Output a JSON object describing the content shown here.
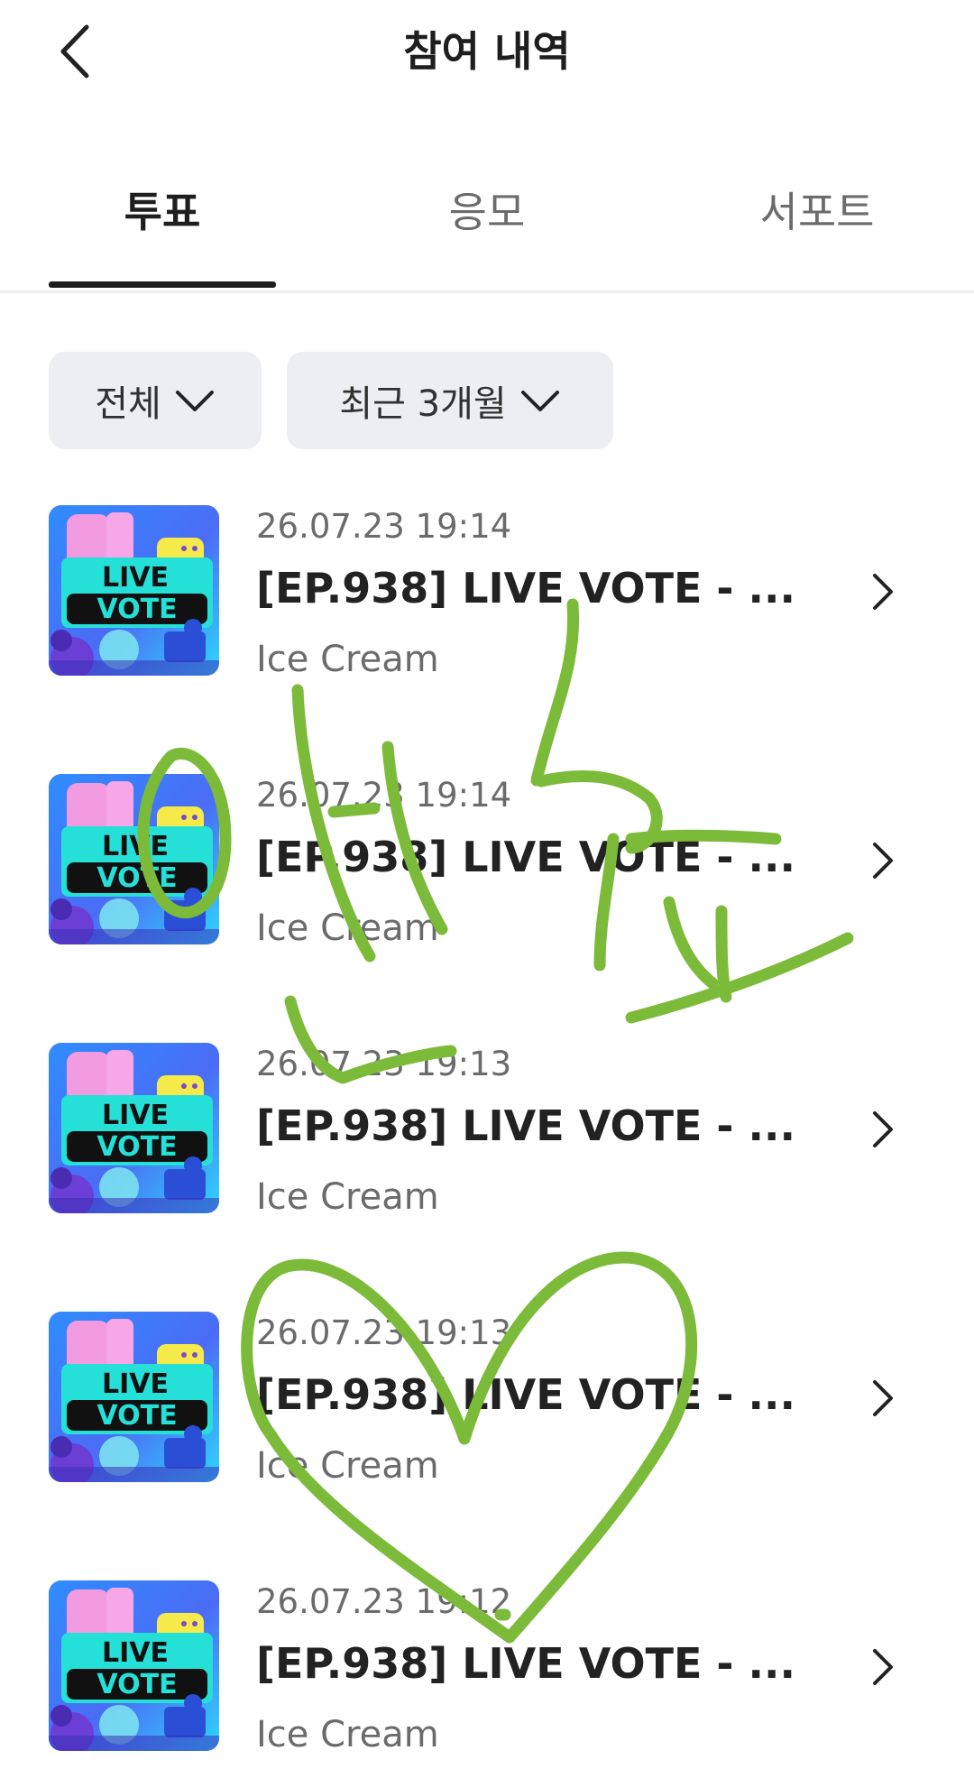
{
  "header": {
    "title": "참여 내역",
    "back_icon": "chevron-left-icon"
  },
  "tabs": [
    {
      "label": "투표",
      "active": true
    },
    {
      "label": "응모",
      "active": false
    },
    {
      "label": "서포트",
      "active": false
    }
  ],
  "filters": {
    "category": "전체",
    "period": "최근 3개월"
  },
  "items": [
    {
      "date": "26.07.23 19:14",
      "title": "[EP.938] LIVE VOTE - ...",
      "artist": "Ice Cream"
    },
    {
      "date": "26.07.23 19:14",
      "title": "[EP.938] LIVE VOTE - ...",
      "artist": "Ice Cream"
    },
    {
      "date": "26.07.23 19:13",
      "title": "[EP.938] LIVE VOTE - ...",
      "artist": "Ice Cream"
    },
    {
      "date": "26.07.23 19:13",
      "title": "[EP.938] LIVE VOTE - ...",
      "artist": "Ice Cream"
    },
    {
      "date": "26.07.23 19:12",
      "title": "[EP.938] LIVE VOTE - ...",
      "artist": "Ice Cream"
    }
  ],
  "thumbnail": {
    "line1": "LIVE",
    "line2": "VOTE"
  },
  "colors": {
    "accent": "#1e1e1e",
    "filter_bg": "#eceef1",
    "scribble": "#7cbb3a"
  }
}
